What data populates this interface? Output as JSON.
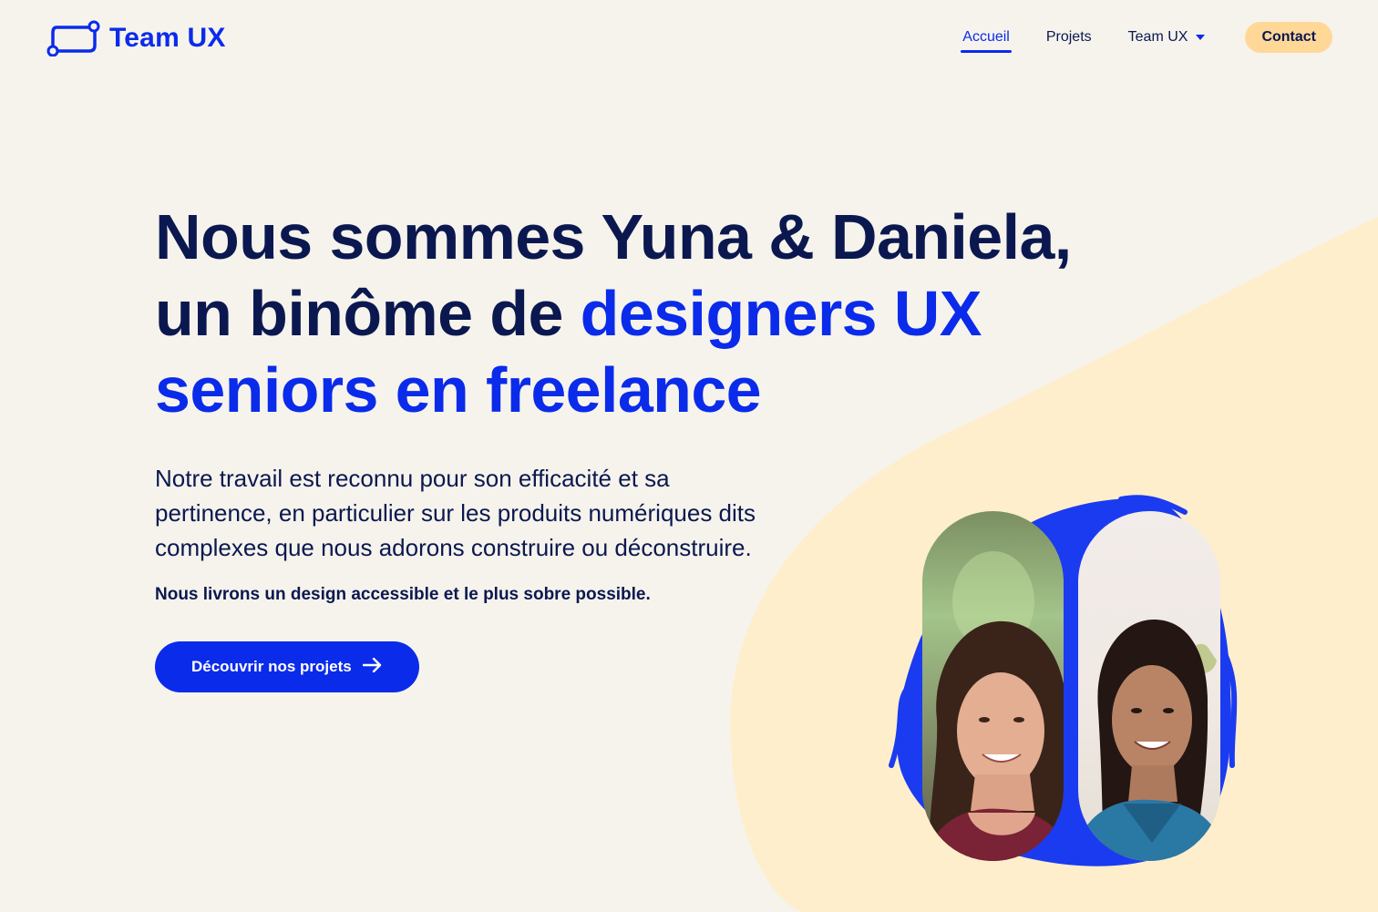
{
  "brand": {
    "name": "Team UX",
    "logo_icon": "link-frame-icon"
  },
  "nav": {
    "items": [
      {
        "label": "Accueil",
        "active": true
      },
      {
        "label": "Projets",
        "active": false
      },
      {
        "label": "Team UX",
        "active": false,
        "has_dropdown": true
      }
    ],
    "contact_label": "Contact"
  },
  "hero": {
    "title_line1": "Nous sommes Yuna & Daniela,",
    "title_line2_plain": "un binôme de ",
    "title_line2_accent": "designers UX",
    "title_line3_accent": "seniors en freelance",
    "description": "Notre travail est reconnu pour son efficacité et sa pertinence, en particulier sur les produits numériques dits complexes que nous adorons construire ou déconstruire.",
    "note": "Nous livrons un design accessible et le plus sobre possible.",
    "cta_label": "Découvrir nos projets",
    "cta_icon": "arrow-right-icon"
  },
  "colors": {
    "background": "#f6f3ec",
    "accent_blue": "#0b2bea",
    "navy": "#0b1850",
    "blob_yellow": "#feeecb",
    "contact_yellow": "#ffd898"
  }
}
